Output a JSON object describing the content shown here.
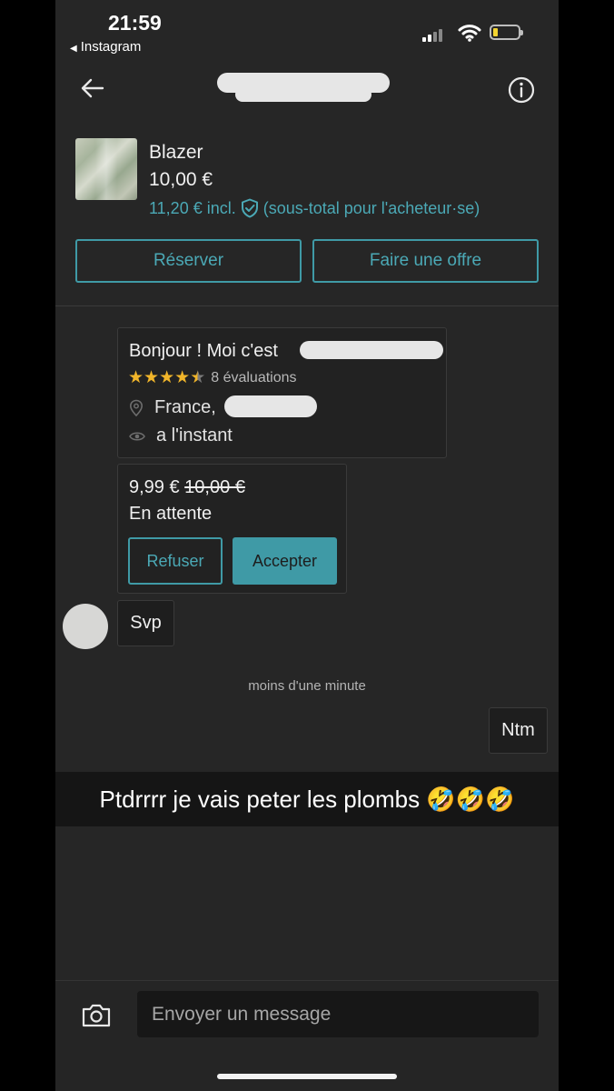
{
  "status_bar": {
    "time": "21:59",
    "back_app_label": "Instagram",
    "back_app_icon": "triangle-left-icon",
    "signal_icon": "cellular-signal-icon",
    "wifi_icon": "wifi-icon",
    "battery_icon": "battery-low-icon",
    "battery_color": "#f3d431"
  },
  "header": {
    "back_icon": "arrow-left-icon",
    "info_icon": "info-circle-icon"
  },
  "product": {
    "title": "Blazer",
    "price": "10,00 €",
    "incl_price": "11,20 € incl.",
    "protection_icon": "shield-check-icon",
    "incl_note": "(sous-total pour l'acheteur·se)",
    "reserve_label": "Réserver",
    "offer_label": "Faire une offre"
  },
  "profile_card": {
    "greeting": "Bonjour ! Moi c'est",
    "rating": 4.5,
    "rating_count": "8 évaluations",
    "location_icon": "map-pin-icon",
    "location": "France,",
    "seen_icon": "eye-icon",
    "last_seen": "a l'instant"
  },
  "offer": {
    "new_price": "9,99 €",
    "old_price": "10,00 €",
    "status": "En attente",
    "refuse_label": "Refuser",
    "accept_label": "Accepter"
  },
  "messages": {
    "incoming_text": "Svp",
    "timestamp": "moins d'une minute",
    "outgoing_text": "Ntm"
  },
  "caption": "Ptdrrrr je vais peter les plombs 🤣🤣🤣",
  "composer": {
    "camera_icon": "camera-icon",
    "placeholder": "Envoyer un message"
  },
  "colors": {
    "accent": "#3f9aa6",
    "star": "#f1b52a",
    "background": "#262626"
  }
}
